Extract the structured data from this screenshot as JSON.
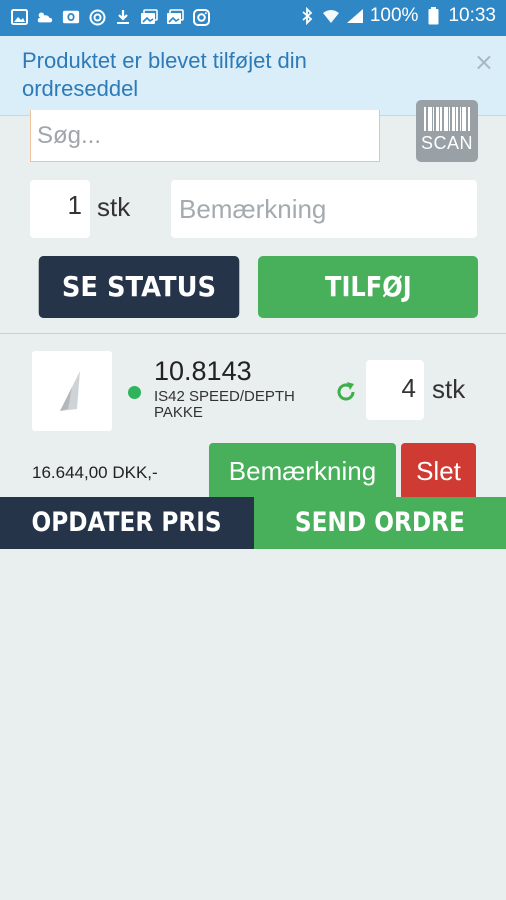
{
  "status_bar": {
    "battery": "100%",
    "time": "10:33",
    "left_icons": [
      "image-icon",
      "cloud-icon",
      "outlook-icon",
      "circle-icon",
      "download-icon",
      "photos-icon",
      "photos-icon",
      "instagram-icon"
    ],
    "right_icons": [
      "bluetooth-icon",
      "wifi-icon",
      "signal-icon",
      "battery-icon"
    ]
  },
  "toast": {
    "message": "Produktet er blevet tilføjet din ordreseddel",
    "close": "×"
  },
  "search": {
    "placeholder": "Søg..."
  },
  "scan_button": {
    "label": "SCAN"
  },
  "quantity": {
    "value": "1",
    "unit": "stk"
  },
  "remark": {
    "placeholder": "Bemærkning"
  },
  "buttons": {
    "status": "SE STATUS",
    "add": "TILFØJ"
  },
  "order_line": {
    "product_number": "10.8143",
    "product_name": "IS42 SPEED/DEPTH PAKKE",
    "quantity": "4",
    "unit": "stk",
    "price": "16.644,00 DKK,-",
    "remark_button": "Bemærkning",
    "delete_button": "Slet"
  },
  "bottom": {
    "update_price": "OPDATER PRIS",
    "send_order": "SEND ORDRE"
  },
  "colors": {
    "status_bar": "#2f87c6",
    "navy": "#26344a",
    "green": "#48b05a",
    "red": "#cf3b32",
    "toast_bg": "#d9eef8",
    "toast_text": "#2e7ab8"
  }
}
